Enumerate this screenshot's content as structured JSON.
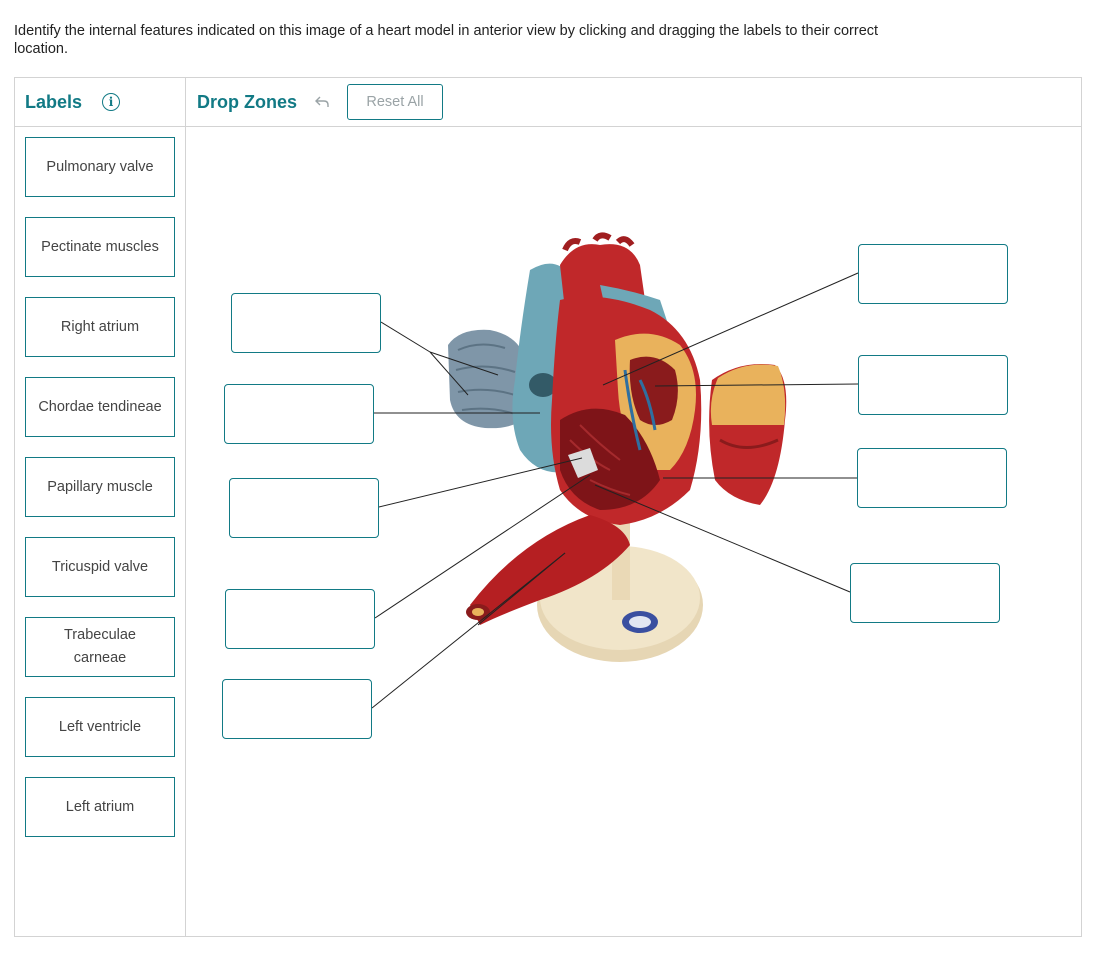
{
  "instructions": "Identify the internal features indicated on this image of a heart model in anterior view by clicking and dragging the labels to their correct location.",
  "labels_panel": {
    "title": "Labels",
    "info_icon": "info-icon",
    "items": [
      {
        "label": "Pulmonary valve"
      },
      {
        "label": "Pectinate muscles"
      },
      {
        "label": "Right atrium"
      },
      {
        "label": "Chordae tendineae"
      },
      {
        "label": "Papillary muscle"
      },
      {
        "label": "Tricuspid valve"
      },
      {
        "label": "Trabeculae carneae"
      },
      {
        "label": "Left ventricle"
      },
      {
        "label": "Left atrium"
      }
    ]
  },
  "drop_zones_panel": {
    "title": "Drop Zones",
    "undo_icon": "undo-arrow-icon",
    "reset_label": "Reset All"
  },
  "colors": {
    "accent": "#127a85",
    "border": "#d3d3d3",
    "muscle_red": "#c0282a",
    "vessel_blue": "#6ea7b7",
    "fat_yellow": "#e9b25c",
    "stand_cream": "#efe2c4"
  }
}
